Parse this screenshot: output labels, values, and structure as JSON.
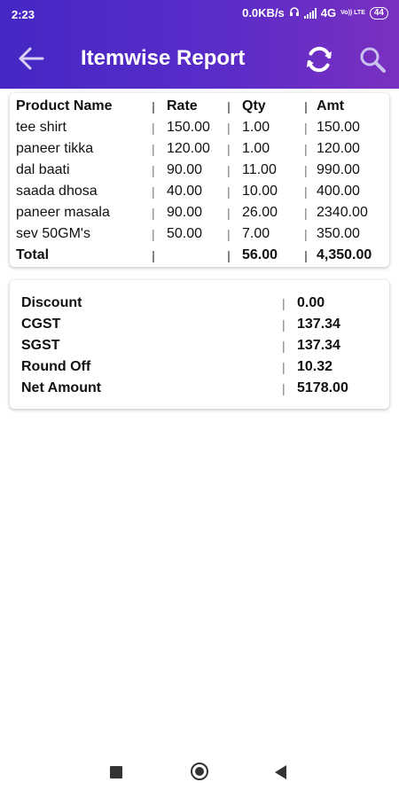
{
  "status_bar": {
    "time": "2:23",
    "net_speed": "0.0KB/s",
    "network": "4G",
    "volte": "Vo)) LTE",
    "battery": "44"
  },
  "header": {
    "title": "Itemwise Report",
    "back_icon": "arrow-left-icon",
    "refresh_icon": "refresh-icon",
    "search_icon": "search-icon",
    "gradient_start": "#4527c4",
    "gradient_end": "#7a30c0"
  },
  "items_table": {
    "columns": [
      "Product Name",
      "Rate",
      "Qty",
      "Amt"
    ],
    "rows": [
      {
        "name": "tee shirt",
        "rate": "150.00",
        "qty": "1.00",
        "amt": "150.00"
      },
      {
        "name": "paneer tikka",
        "rate": "120.00",
        "qty": "1.00",
        "amt": "120.00"
      },
      {
        "name": "dal baati",
        "rate": "90.00",
        "qty": "11.00",
        "amt": "990.00"
      },
      {
        "name": "saada dhosa",
        "rate": "40.00",
        "qty": "10.00",
        "amt": "400.00"
      },
      {
        "name": "paneer masala",
        "rate": "90.00",
        "qty": "26.00",
        "amt": "2340.00"
      },
      {
        "name": "sev 50GM's",
        "rate": "50.00",
        "qty": "7.00",
        "amt": "350.00"
      }
    ],
    "total": {
      "label": "Total",
      "rate": "",
      "qty": "56.00",
      "amt": "4,350.00"
    },
    "separator": "|"
  },
  "summary": {
    "rows": [
      {
        "label": "Discount",
        "value": "0.00"
      },
      {
        "label": "CGST",
        "value": "137.34"
      },
      {
        "label": "SGST",
        "value": "137.34"
      },
      {
        "label": "Round Off",
        "value": "10.32"
      },
      {
        "label": "Net Amount",
        "value": "5178.00"
      }
    ]
  },
  "nav_bar": {
    "recent_icon": "square-recent-apps-icon",
    "home_icon": "circle-home-icon",
    "back_icon": "triangle-back-icon"
  }
}
